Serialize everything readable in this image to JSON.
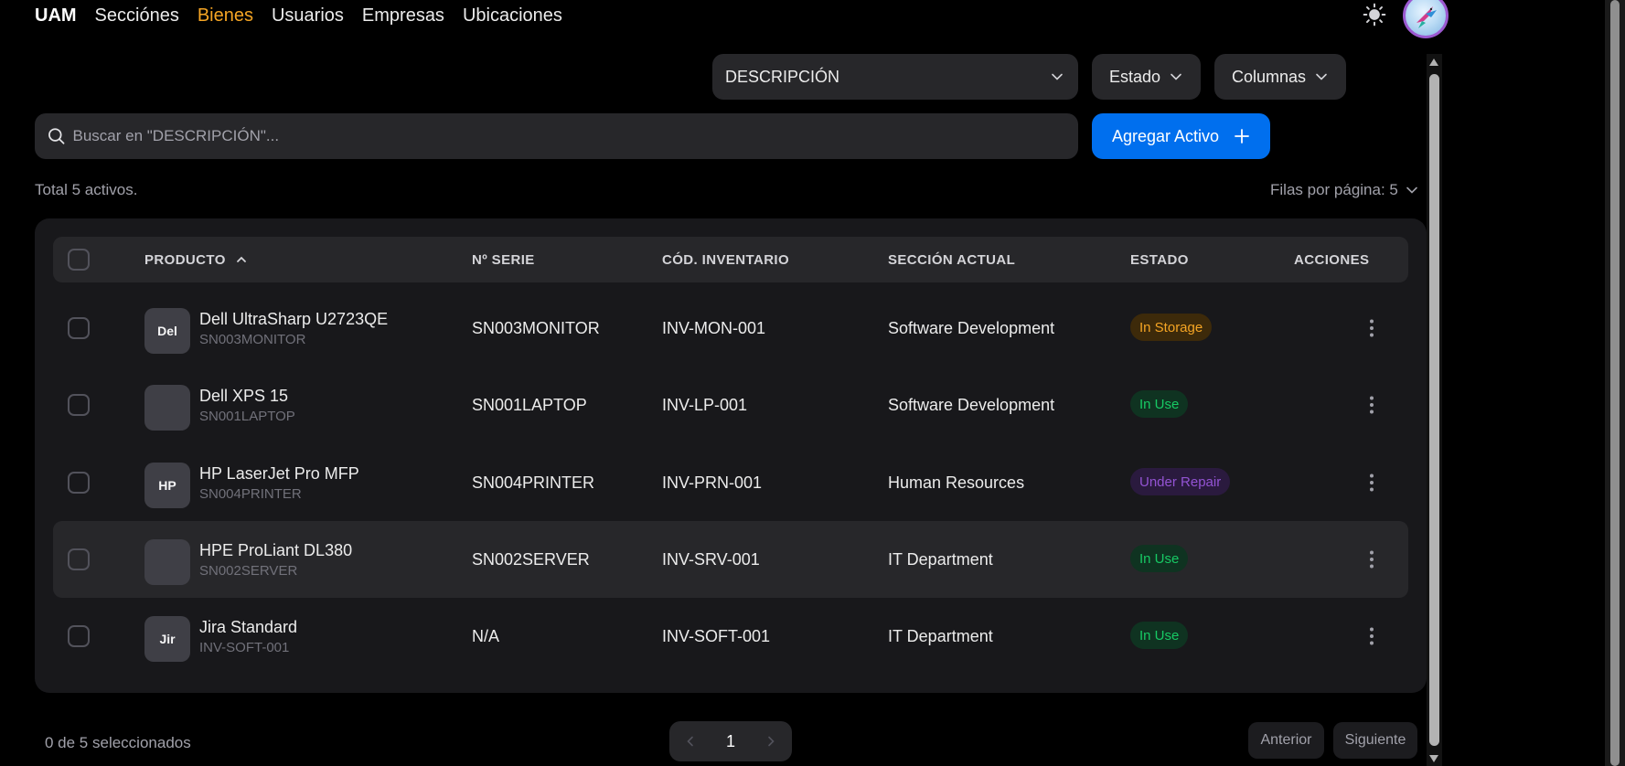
{
  "nav": {
    "brand": "UAM",
    "links": [
      "Secciónes",
      "Bienes",
      "Usuarios",
      "Empresas",
      "Ubicaciones"
    ],
    "active": "Bienes"
  },
  "filters": {
    "column_select": "DESCRIPCIÓN",
    "estado": "Estado",
    "columnas": "Columnas"
  },
  "search": {
    "placeholder": "Buscar en \"DESCRIPCIÓN\"..."
  },
  "add_button": {
    "label": "Agregar Activo"
  },
  "summary": {
    "total": "Total 5 activos.",
    "per_page": "Filas por página: 5"
  },
  "table": {
    "headers": {
      "producto": "PRODUCTO",
      "serie": "Nº SERIE",
      "inventario": "CÓD. INVENTARIO",
      "seccion": "SECCIÓN ACTUAL",
      "estado": "ESTADO",
      "acciones": "ACCIONES"
    },
    "rows": [
      {
        "thumb": "Del",
        "name": "Dell UltraSharp U2723QE",
        "sub": "SN003MONITOR",
        "serie": "SN003MONITOR",
        "inventario": "INV-MON-001",
        "seccion": "Software Development",
        "estado": "In Storage",
        "status_type": "storage"
      },
      {
        "thumb": "",
        "name": "Dell XPS 15",
        "sub": "SN001LAPTOP",
        "serie": "SN001LAPTOP",
        "inventario": "INV-LP-001",
        "seccion": "Software Development",
        "estado": "In Use",
        "status_type": "use"
      },
      {
        "thumb": "HP",
        "name": "HP LaserJet Pro MFP",
        "sub": "SN004PRINTER",
        "serie": "SN004PRINTER",
        "inventario": "INV-PRN-001",
        "seccion": "Human Resources",
        "estado": "Under Repair",
        "status_type": "repair"
      },
      {
        "thumb": "",
        "name": "HPE ProLiant DL380",
        "sub": "SN002SERVER",
        "serie": "SN002SERVER",
        "inventario": "INV-SRV-001",
        "seccion": "IT Department",
        "estado": "In Use",
        "status_type": "use"
      },
      {
        "thumb": "Jir",
        "name": "Jira Standard",
        "sub": "INV-SOFT-001",
        "serie": "N/A",
        "inventario": "INV-SOFT-001",
        "seccion": "IT Department",
        "estado": "In Use",
        "status_type": "use"
      }
    ]
  },
  "footer": {
    "selected": "0 de 5 seleccionados",
    "page": "1",
    "prev": "Anterior",
    "next": "Siguiente"
  },
  "colors": {
    "accent": "#006fee",
    "active_nav": "#f5a524",
    "storage_text": "#f5a524",
    "storage_bg": "#3d2a0a",
    "use_text": "#17c964",
    "use_bg": "#0f3321",
    "repair_text": "#9353d3",
    "repair_bg": "#2a1a3e"
  }
}
